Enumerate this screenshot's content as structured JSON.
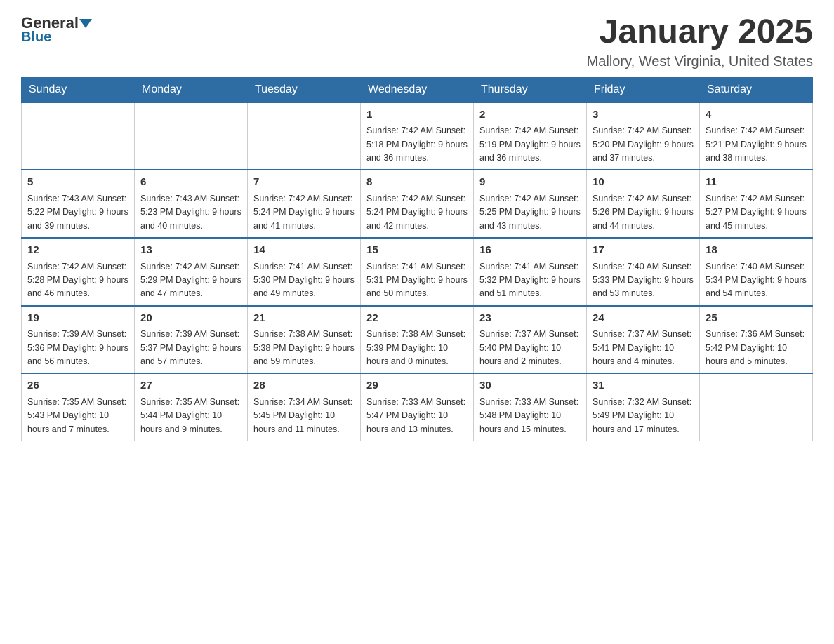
{
  "header": {
    "logo_general": "General",
    "logo_blue": "Blue",
    "month_title": "January 2025",
    "location": "Mallory, West Virginia, United States"
  },
  "days_of_week": [
    "Sunday",
    "Monday",
    "Tuesday",
    "Wednesday",
    "Thursday",
    "Friday",
    "Saturday"
  ],
  "weeks": [
    [
      {
        "num": "",
        "info": ""
      },
      {
        "num": "",
        "info": ""
      },
      {
        "num": "",
        "info": ""
      },
      {
        "num": "1",
        "info": "Sunrise: 7:42 AM\nSunset: 5:18 PM\nDaylight: 9 hours\nand 36 minutes."
      },
      {
        "num": "2",
        "info": "Sunrise: 7:42 AM\nSunset: 5:19 PM\nDaylight: 9 hours\nand 36 minutes."
      },
      {
        "num": "3",
        "info": "Sunrise: 7:42 AM\nSunset: 5:20 PM\nDaylight: 9 hours\nand 37 minutes."
      },
      {
        "num": "4",
        "info": "Sunrise: 7:42 AM\nSunset: 5:21 PM\nDaylight: 9 hours\nand 38 minutes."
      }
    ],
    [
      {
        "num": "5",
        "info": "Sunrise: 7:43 AM\nSunset: 5:22 PM\nDaylight: 9 hours\nand 39 minutes."
      },
      {
        "num": "6",
        "info": "Sunrise: 7:43 AM\nSunset: 5:23 PM\nDaylight: 9 hours\nand 40 minutes."
      },
      {
        "num": "7",
        "info": "Sunrise: 7:42 AM\nSunset: 5:24 PM\nDaylight: 9 hours\nand 41 minutes."
      },
      {
        "num": "8",
        "info": "Sunrise: 7:42 AM\nSunset: 5:24 PM\nDaylight: 9 hours\nand 42 minutes."
      },
      {
        "num": "9",
        "info": "Sunrise: 7:42 AM\nSunset: 5:25 PM\nDaylight: 9 hours\nand 43 minutes."
      },
      {
        "num": "10",
        "info": "Sunrise: 7:42 AM\nSunset: 5:26 PM\nDaylight: 9 hours\nand 44 minutes."
      },
      {
        "num": "11",
        "info": "Sunrise: 7:42 AM\nSunset: 5:27 PM\nDaylight: 9 hours\nand 45 minutes."
      }
    ],
    [
      {
        "num": "12",
        "info": "Sunrise: 7:42 AM\nSunset: 5:28 PM\nDaylight: 9 hours\nand 46 minutes."
      },
      {
        "num": "13",
        "info": "Sunrise: 7:42 AM\nSunset: 5:29 PM\nDaylight: 9 hours\nand 47 minutes."
      },
      {
        "num": "14",
        "info": "Sunrise: 7:41 AM\nSunset: 5:30 PM\nDaylight: 9 hours\nand 49 minutes."
      },
      {
        "num": "15",
        "info": "Sunrise: 7:41 AM\nSunset: 5:31 PM\nDaylight: 9 hours\nand 50 minutes."
      },
      {
        "num": "16",
        "info": "Sunrise: 7:41 AM\nSunset: 5:32 PM\nDaylight: 9 hours\nand 51 minutes."
      },
      {
        "num": "17",
        "info": "Sunrise: 7:40 AM\nSunset: 5:33 PM\nDaylight: 9 hours\nand 53 minutes."
      },
      {
        "num": "18",
        "info": "Sunrise: 7:40 AM\nSunset: 5:34 PM\nDaylight: 9 hours\nand 54 minutes."
      }
    ],
    [
      {
        "num": "19",
        "info": "Sunrise: 7:39 AM\nSunset: 5:36 PM\nDaylight: 9 hours\nand 56 minutes."
      },
      {
        "num": "20",
        "info": "Sunrise: 7:39 AM\nSunset: 5:37 PM\nDaylight: 9 hours\nand 57 minutes."
      },
      {
        "num": "21",
        "info": "Sunrise: 7:38 AM\nSunset: 5:38 PM\nDaylight: 9 hours\nand 59 minutes."
      },
      {
        "num": "22",
        "info": "Sunrise: 7:38 AM\nSunset: 5:39 PM\nDaylight: 10 hours\nand 0 minutes."
      },
      {
        "num": "23",
        "info": "Sunrise: 7:37 AM\nSunset: 5:40 PM\nDaylight: 10 hours\nand 2 minutes."
      },
      {
        "num": "24",
        "info": "Sunrise: 7:37 AM\nSunset: 5:41 PM\nDaylight: 10 hours\nand 4 minutes."
      },
      {
        "num": "25",
        "info": "Sunrise: 7:36 AM\nSunset: 5:42 PM\nDaylight: 10 hours\nand 5 minutes."
      }
    ],
    [
      {
        "num": "26",
        "info": "Sunrise: 7:35 AM\nSunset: 5:43 PM\nDaylight: 10 hours\nand 7 minutes."
      },
      {
        "num": "27",
        "info": "Sunrise: 7:35 AM\nSunset: 5:44 PM\nDaylight: 10 hours\nand 9 minutes."
      },
      {
        "num": "28",
        "info": "Sunrise: 7:34 AM\nSunset: 5:45 PM\nDaylight: 10 hours\nand 11 minutes."
      },
      {
        "num": "29",
        "info": "Sunrise: 7:33 AM\nSunset: 5:47 PM\nDaylight: 10 hours\nand 13 minutes."
      },
      {
        "num": "30",
        "info": "Sunrise: 7:33 AM\nSunset: 5:48 PM\nDaylight: 10 hours\nand 15 minutes."
      },
      {
        "num": "31",
        "info": "Sunrise: 7:32 AM\nSunset: 5:49 PM\nDaylight: 10 hours\nand 17 minutes."
      },
      {
        "num": "",
        "info": ""
      }
    ]
  ]
}
